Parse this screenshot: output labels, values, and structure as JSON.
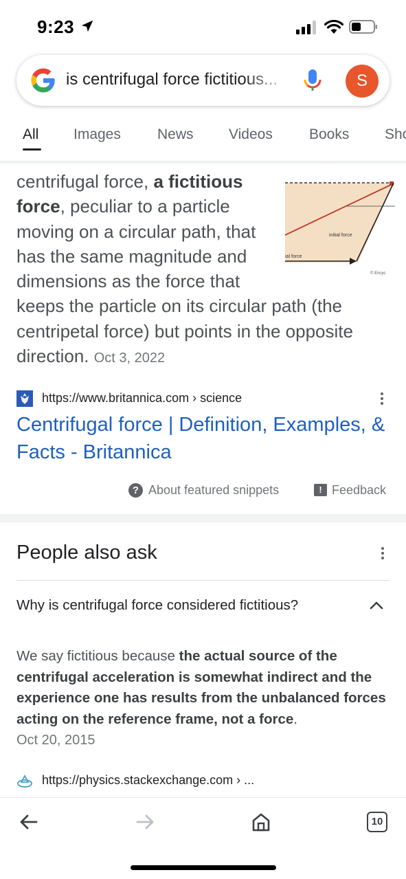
{
  "status_bar": {
    "time": "9:23"
  },
  "search": {
    "query": "is centrifugal force fictitious...",
    "avatar_letter": "S"
  },
  "tabs": [
    {
      "label": "All",
      "active": true
    },
    {
      "label": "Images"
    },
    {
      "label": "News"
    },
    {
      "label": "Videos"
    },
    {
      "label": "Books"
    },
    {
      "label": "Sho"
    }
  ],
  "snippet": {
    "text_1": "centrifugal force, ",
    "bold_1": "a fictitious force",
    "text_2": ", peculiar to a particle moving on a circular path, that has the same magnitude and dimensions as the force that keeps the particle on its circular path (the centripetal force) but points in the opposite direction.",
    "date": "Oct 3, 2022",
    "image_labels": {
      "initial_force": "initial force",
      "tial_force": "ial force",
      "credit": "© Encyc"
    }
  },
  "result": {
    "url": "https://www.britannica.com › science",
    "title": "Centrifugal force | Definition, Examples, & Facts - Britannica"
  },
  "footer_links": {
    "about": "About featured snippets",
    "feedback": "Feedback"
  },
  "people_also_ask": {
    "heading": "People also ask",
    "question": "Why is centrifugal force considered fictitious?",
    "answer_text_1": "We say fictitious because ",
    "answer_bold": "the actual source of the centrifugal acceleration is somewhat indirect and the experience one has results from the unbalanced forces acting on the reference frame, not a force",
    "answer_text_2": ".",
    "answer_date": "Oct 20, 2015",
    "source_url": "https://physics.stackexchange.com › ..."
  },
  "bottom_bar": {
    "tab_count": "10"
  },
  "colors": {
    "link": "#1f5fbf",
    "avatar": "#e8562b",
    "google_blue": "#4285f4",
    "google_red": "#ea4335",
    "google_yellow": "#fbbc05",
    "google_green": "#34a853"
  }
}
